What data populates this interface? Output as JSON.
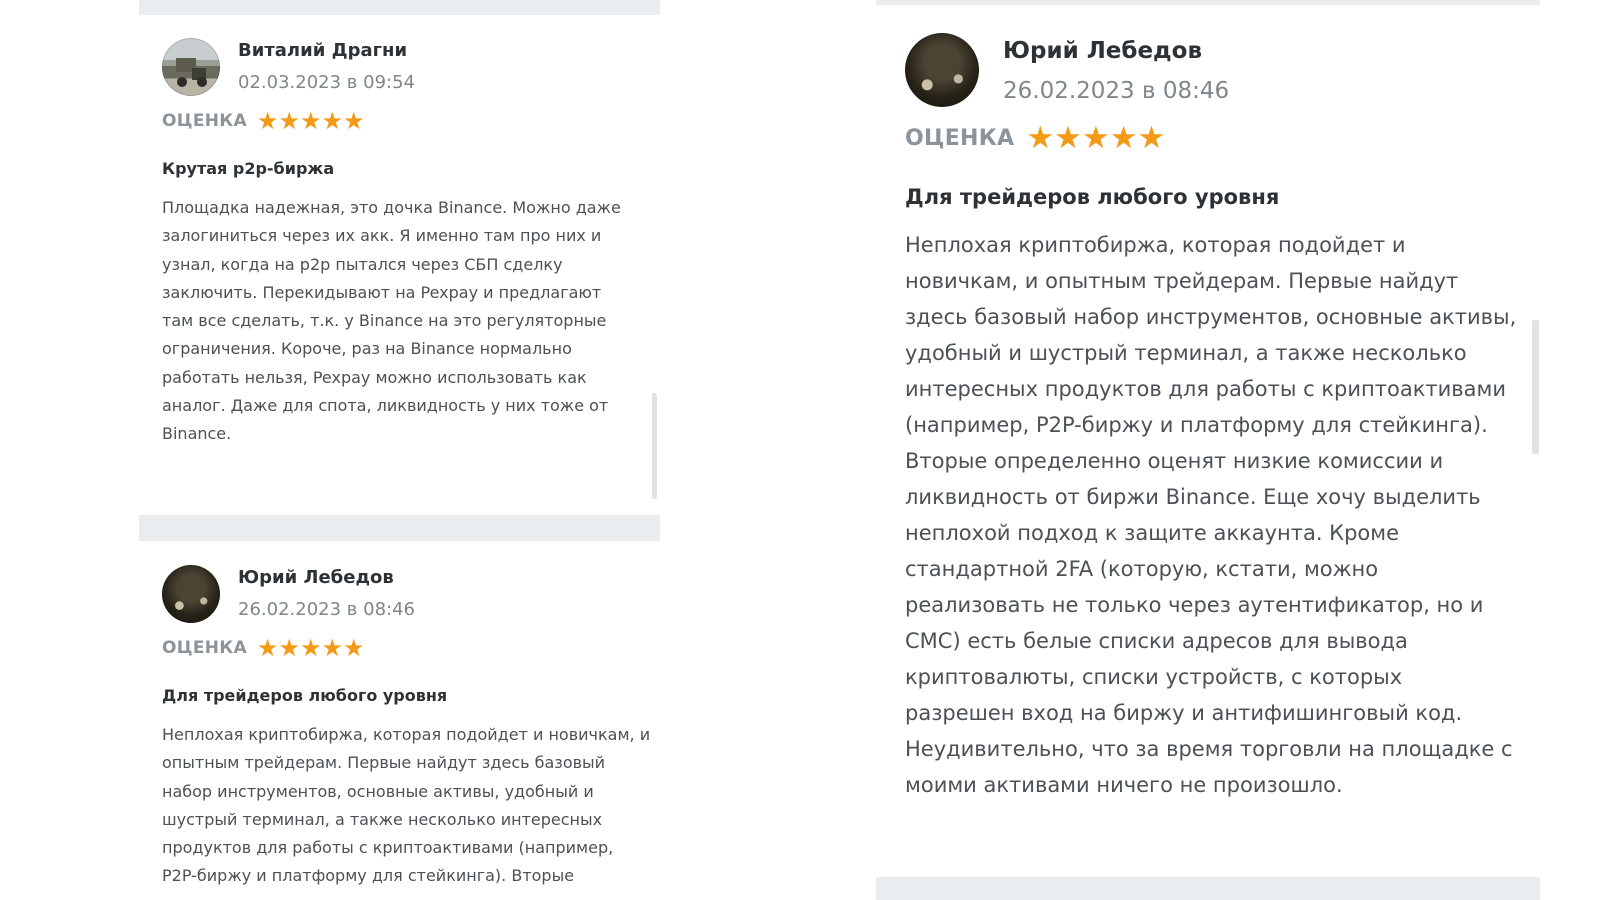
{
  "reviews": [
    {
      "author": "Виталий Драгни",
      "date": "02.03.2023 в 09:54",
      "rating_label": "ОЦЕНКА",
      "stars": 5,
      "title": "Крутая p2p-биржа",
      "text": "Площадка надежная, это дочка Binance. Можно даже залогиниться через их акк. Я именно там про них и узнал, когда на p2p пытался через СБП сделку заключить. Перекидывают на Pexpay и предлагают там все сделать, т.к. у Binance на это регуляторные ограничения. Короче, раз на Binance нормально работать нельзя, Pexpay можно использовать как аналог. Даже для спота, ликвидность у них тоже от Binance."
    },
    {
      "author": "Юрий Лебедов",
      "date": "26.02.2023 в 08:46",
      "rating_label": "ОЦЕНКА",
      "stars": 5,
      "title": "Для трейдеров любого уровня",
      "text": "Неплохая криптобиржа, которая подойдет и новичкам, и опытным трейдерам. Первые найдут здесь базовый набор инструментов, основные активы, удобный и шустрый терминал, а также несколько интересных продуктов для работы с криптоактивами (например, P2P-биржу и платформу для стейкинга). Вторые"
    },
    {
      "author": "Юрий Лебедов",
      "date": "26.02.2023 в 08:46",
      "rating_label": "ОЦЕНКА",
      "stars": 5,
      "title": "Для трейдеров любого уровня",
      "text": "Неплохая криптобиржа, которая подойдет и новичкам, и опытным трейдерам. Первые найдут здесь базовый набор инструментов, основные активы, удобный и шустрый терминал, а также несколько интересных продуктов для работы с криптоактивами (например, P2P-биржу и платформу для стейкинга). Вторые определенно оценят низкие комиссии и ликвидность от биржи Binance. Еще хочу выделить неплохой подход к защите аккаунта. Кроме стандартной 2FA (которую, кстати, можно реализовать не только через аутентификатор, но и СМС) есть белые списки адресов для вывода криптовалюты, списки устройств, с которых разрешен вход на биржу и антифишинговый код. Неудивительно, что за время торговли на площадке с моими активами ничего не произошло."
    }
  ],
  "colors": {
    "star": "#f39a17",
    "separator": "#eaedf0",
    "label": "#8c949a"
  }
}
